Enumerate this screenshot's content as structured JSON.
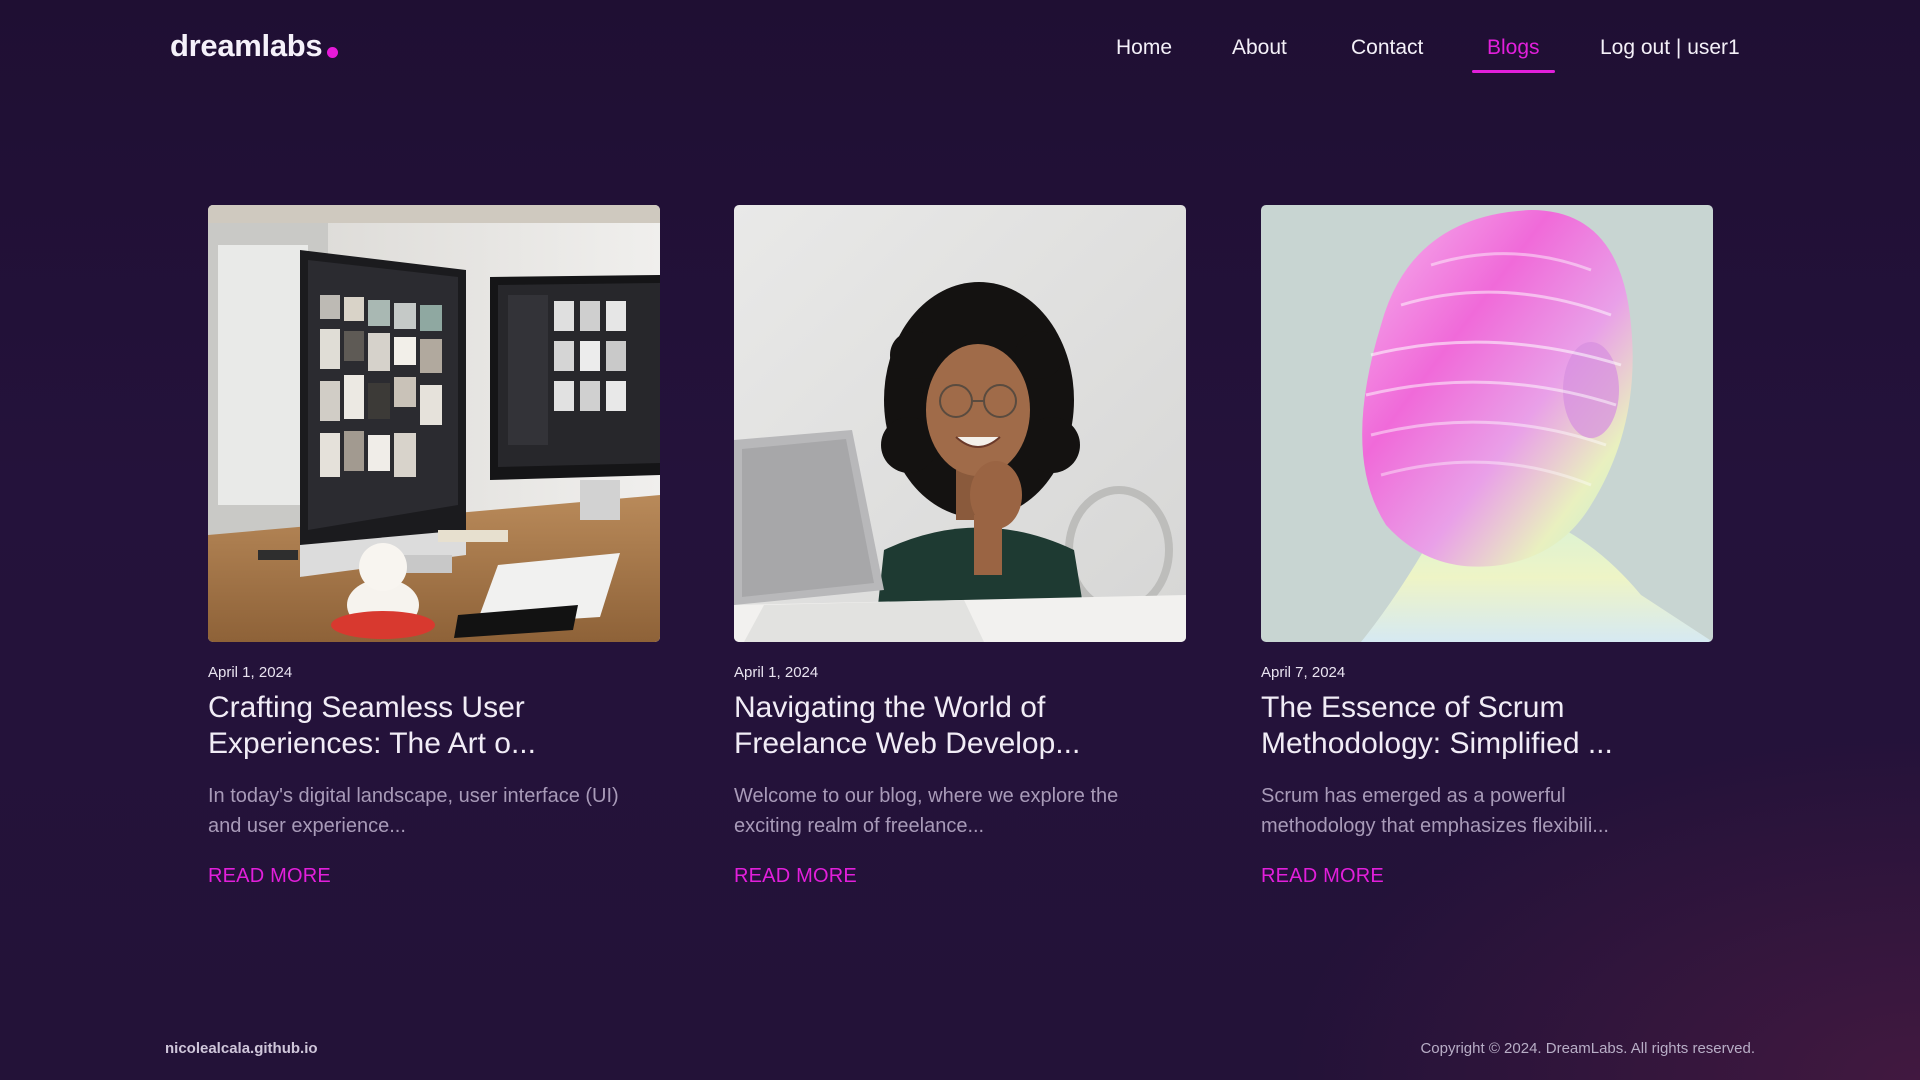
{
  "brand": {
    "name": "dreamlabs",
    "accent_color": "#e21fdb"
  },
  "nav": {
    "items": [
      {
        "label": "Home"
      },
      {
        "label": "About"
      },
      {
        "label": "Contact"
      },
      {
        "label": "Blogs",
        "active": true
      },
      {
        "label": "Log out | user1"
      }
    ]
  },
  "posts": [
    {
      "date": "April 1, 2024",
      "title": "Crafting Seamless User Experiences: The Art o...",
      "excerpt": "In today's digital landscape, user interface (UI) and user experience...",
      "read_more": "READ MORE",
      "image": "desk-monitors-photo"
    },
    {
      "date": "April 1, 2024",
      "title": "Navigating the World of Freelance Web Develop...",
      "excerpt": "Welcome to our blog, where we explore the exciting realm of freelance...",
      "read_more": "READ MORE",
      "image": "woman-laptop-photo"
    },
    {
      "date": "April 7, 2024",
      "title": "The Essence of Scrum Methodology: Simplified ...",
      "excerpt": "Scrum has emerged as a powerful methodology that emphasizes flexibili...",
      "read_more": "READ MORE",
      "image": "holographic-head-render"
    }
  ],
  "footer": {
    "site": "nicolealcala.github.io",
    "copyright": "Copyright © 2024. DreamLabs. All rights reserved."
  }
}
